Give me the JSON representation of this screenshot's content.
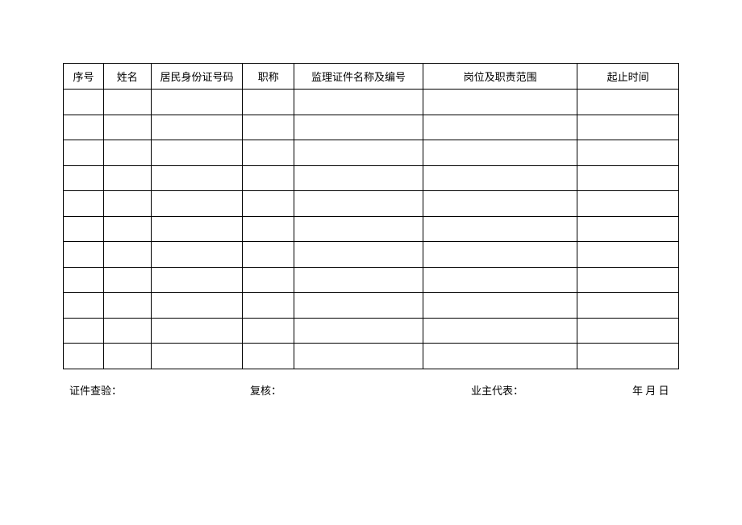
{
  "table": {
    "headers": {
      "seq": "序号",
      "name": "姓名",
      "id": "居民身份证号码",
      "title": "职称",
      "cert": "监理证件名称及编号",
      "role": "岗位及职责范围",
      "time": "起止时间"
    },
    "row_count": 11
  },
  "footer": {
    "cert_check": "证件查验：",
    "review": "复核：",
    "owner_rep": "业主代表：",
    "date": "年 月 日"
  }
}
